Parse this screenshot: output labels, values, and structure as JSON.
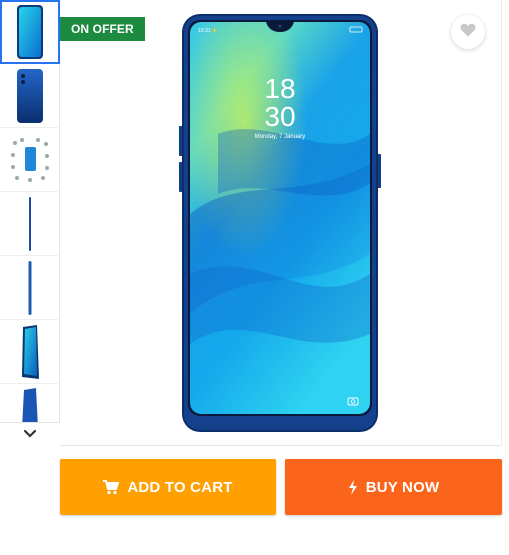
{
  "badge": {
    "offer_label": "ON OFFER"
  },
  "phone_screen": {
    "clock_hour": "18",
    "clock_minute": "30",
    "date_text": "Monday, 7 January"
  },
  "gallery": {
    "thumbnails": [
      "front-view",
      "back-view",
      "features-collage",
      "side-view-thin",
      "side-view-edge",
      "angled-front",
      "angled-back"
    ],
    "active_index": 0
  },
  "actions": {
    "add_to_cart_label": "ADD TO CART",
    "buy_now_label": "BUY NOW"
  },
  "colors": {
    "add_to_cart": "#ff9f00",
    "buy_now": "#fb641b",
    "offer_badge": "#1c8a3f",
    "active_thumb_border": "#2874f0"
  },
  "icons": {
    "wishlist": "heart-icon",
    "cart": "cart-icon",
    "buy": "lightning-icon",
    "scroll": "chevron-down-icon"
  }
}
